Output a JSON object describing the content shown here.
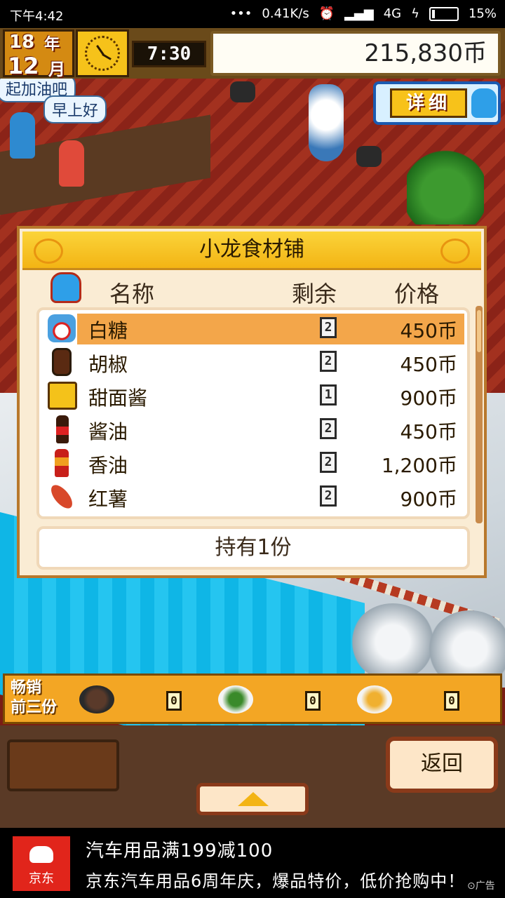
{
  "status_bar": {
    "time": "下午4:42",
    "dots": "•••",
    "net_speed": "0.41K/s",
    "network": "4G",
    "battery": "15%"
  },
  "hud": {
    "year": "18",
    "year_unit": "年",
    "month": "12",
    "month_unit": "月",
    "time": "7:30",
    "money": "215,830币",
    "detail_label": "详细"
  },
  "bubbles": {
    "a": "起加油吧",
    "b": "早上好"
  },
  "shop": {
    "title": "小龙食材铺",
    "col_name": "名称",
    "col_remaining": "剩余",
    "col_price": "价格",
    "items": [
      {
        "name": "白糖",
        "qty": "2",
        "price": "450币",
        "icon": "sugar-jar-icon"
      },
      {
        "name": "胡椒",
        "qty": "2",
        "price": "450币",
        "icon": "pepper-jar-icon"
      },
      {
        "name": "甜面酱",
        "qty": "1",
        "price": "900币",
        "icon": "sauce-box-icon"
      },
      {
        "name": "酱油",
        "qty": "2",
        "price": "450币",
        "icon": "soy-sauce-bottle-icon"
      },
      {
        "name": "香油",
        "qty": "2",
        "price": "1,200币",
        "icon": "sesame-oil-bottle-icon"
      },
      {
        "name": "红薯",
        "qty": "2",
        "price": "900币",
        "icon": "sweet-potato-icon"
      }
    ],
    "owned": "持有1份"
  },
  "best_sellers": {
    "label_line1": "畅销",
    "label_line2": "前三份",
    "counts": [
      "0",
      "0",
      "0"
    ]
  },
  "controls": {
    "back": "返回"
  },
  "ad": {
    "brand": "京东",
    "line1": "汽车用品满199减100",
    "line2": "京东汽车用品6周年庆，爆品特价，低价抢购中！",
    "tag": "广告"
  }
}
